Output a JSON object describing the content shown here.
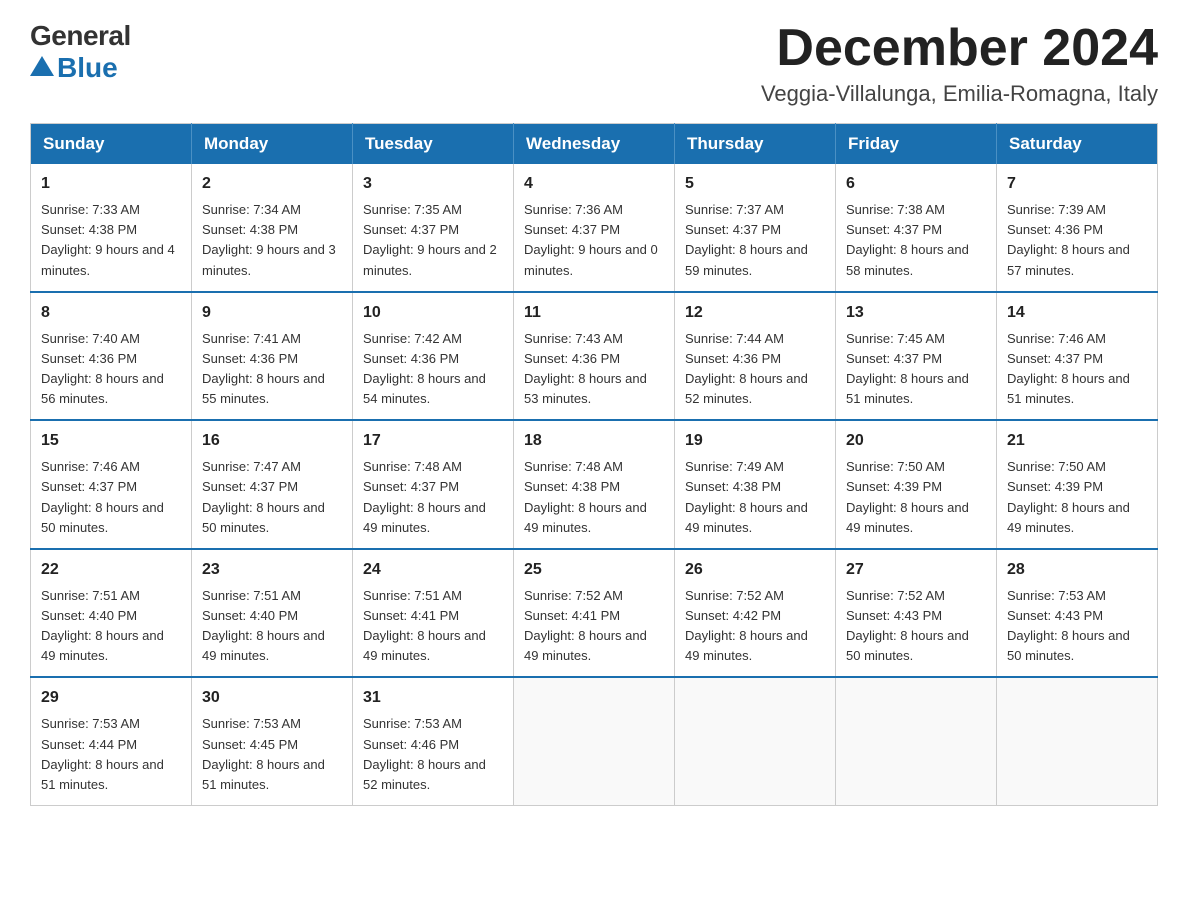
{
  "logo": {
    "general": "General",
    "blue": "Blue"
  },
  "header": {
    "month_year": "December 2024",
    "location": "Veggia-Villalunga, Emilia-Romagna, Italy"
  },
  "weekdays": [
    "Sunday",
    "Monday",
    "Tuesday",
    "Wednesday",
    "Thursday",
    "Friday",
    "Saturday"
  ],
  "weeks": [
    [
      {
        "day": "1",
        "sunrise": "7:33 AM",
        "sunset": "4:38 PM",
        "daylight": "9 hours and 4 minutes."
      },
      {
        "day": "2",
        "sunrise": "7:34 AM",
        "sunset": "4:38 PM",
        "daylight": "9 hours and 3 minutes."
      },
      {
        "day": "3",
        "sunrise": "7:35 AM",
        "sunset": "4:37 PM",
        "daylight": "9 hours and 2 minutes."
      },
      {
        "day": "4",
        "sunrise": "7:36 AM",
        "sunset": "4:37 PM",
        "daylight": "9 hours and 0 minutes."
      },
      {
        "day": "5",
        "sunrise": "7:37 AM",
        "sunset": "4:37 PM",
        "daylight": "8 hours and 59 minutes."
      },
      {
        "day": "6",
        "sunrise": "7:38 AM",
        "sunset": "4:37 PM",
        "daylight": "8 hours and 58 minutes."
      },
      {
        "day": "7",
        "sunrise": "7:39 AM",
        "sunset": "4:36 PM",
        "daylight": "8 hours and 57 minutes."
      }
    ],
    [
      {
        "day": "8",
        "sunrise": "7:40 AM",
        "sunset": "4:36 PM",
        "daylight": "8 hours and 56 minutes."
      },
      {
        "day": "9",
        "sunrise": "7:41 AM",
        "sunset": "4:36 PM",
        "daylight": "8 hours and 55 minutes."
      },
      {
        "day": "10",
        "sunrise": "7:42 AM",
        "sunset": "4:36 PM",
        "daylight": "8 hours and 54 minutes."
      },
      {
        "day": "11",
        "sunrise": "7:43 AM",
        "sunset": "4:36 PM",
        "daylight": "8 hours and 53 minutes."
      },
      {
        "day": "12",
        "sunrise": "7:44 AM",
        "sunset": "4:36 PM",
        "daylight": "8 hours and 52 minutes."
      },
      {
        "day": "13",
        "sunrise": "7:45 AM",
        "sunset": "4:37 PM",
        "daylight": "8 hours and 51 minutes."
      },
      {
        "day": "14",
        "sunrise": "7:46 AM",
        "sunset": "4:37 PM",
        "daylight": "8 hours and 51 minutes."
      }
    ],
    [
      {
        "day": "15",
        "sunrise": "7:46 AM",
        "sunset": "4:37 PM",
        "daylight": "8 hours and 50 minutes."
      },
      {
        "day": "16",
        "sunrise": "7:47 AM",
        "sunset": "4:37 PM",
        "daylight": "8 hours and 50 minutes."
      },
      {
        "day": "17",
        "sunrise": "7:48 AM",
        "sunset": "4:37 PM",
        "daylight": "8 hours and 49 minutes."
      },
      {
        "day": "18",
        "sunrise": "7:48 AM",
        "sunset": "4:38 PM",
        "daylight": "8 hours and 49 minutes."
      },
      {
        "day": "19",
        "sunrise": "7:49 AM",
        "sunset": "4:38 PM",
        "daylight": "8 hours and 49 minutes."
      },
      {
        "day": "20",
        "sunrise": "7:50 AM",
        "sunset": "4:39 PM",
        "daylight": "8 hours and 49 minutes."
      },
      {
        "day": "21",
        "sunrise": "7:50 AM",
        "sunset": "4:39 PM",
        "daylight": "8 hours and 49 minutes."
      }
    ],
    [
      {
        "day": "22",
        "sunrise": "7:51 AM",
        "sunset": "4:40 PM",
        "daylight": "8 hours and 49 minutes."
      },
      {
        "day": "23",
        "sunrise": "7:51 AM",
        "sunset": "4:40 PM",
        "daylight": "8 hours and 49 minutes."
      },
      {
        "day": "24",
        "sunrise": "7:51 AM",
        "sunset": "4:41 PM",
        "daylight": "8 hours and 49 minutes."
      },
      {
        "day": "25",
        "sunrise": "7:52 AM",
        "sunset": "4:41 PM",
        "daylight": "8 hours and 49 minutes."
      },
      {
        "day": "26",
        "sunrise": "7:52 AM",
        "sunset": "4:42 PM",
        "daylight": "8 hours and 49 minutes."
      },
      {
        "day": "27",
        "sunrise": "7:52 AM",
        "sunset": "4:43 PM",
        "daylight": "8 hours and 50 minutes."
      },
      {
        "day": "28",
        "sunrise": "7:53 AM",
        "sunset": "4:43 PM",
        "daylight": "8 hours and 50 minutes."
      }
    ],
    [
      {
        "day": "29",
        "sunrise": "7:53 AM",
        "sunset": "4:44 PM",
        "daylight": "8 hours and 51 minutes."
      },
      {
        "day": "30",
        "sunrise": "7:53 AM",
        "sunset": "4:45 PM",
        "daylight": "8 hours and 51 minutes."
      },
      {
        "day": "31",
        "sunrise": "7:53 AM",
        "sunset": "4:46 PM",
        "daylight": "8 hours and 52 minutes."
      },
      null,
      null,
      null,
      null
    ]
  ]
}
